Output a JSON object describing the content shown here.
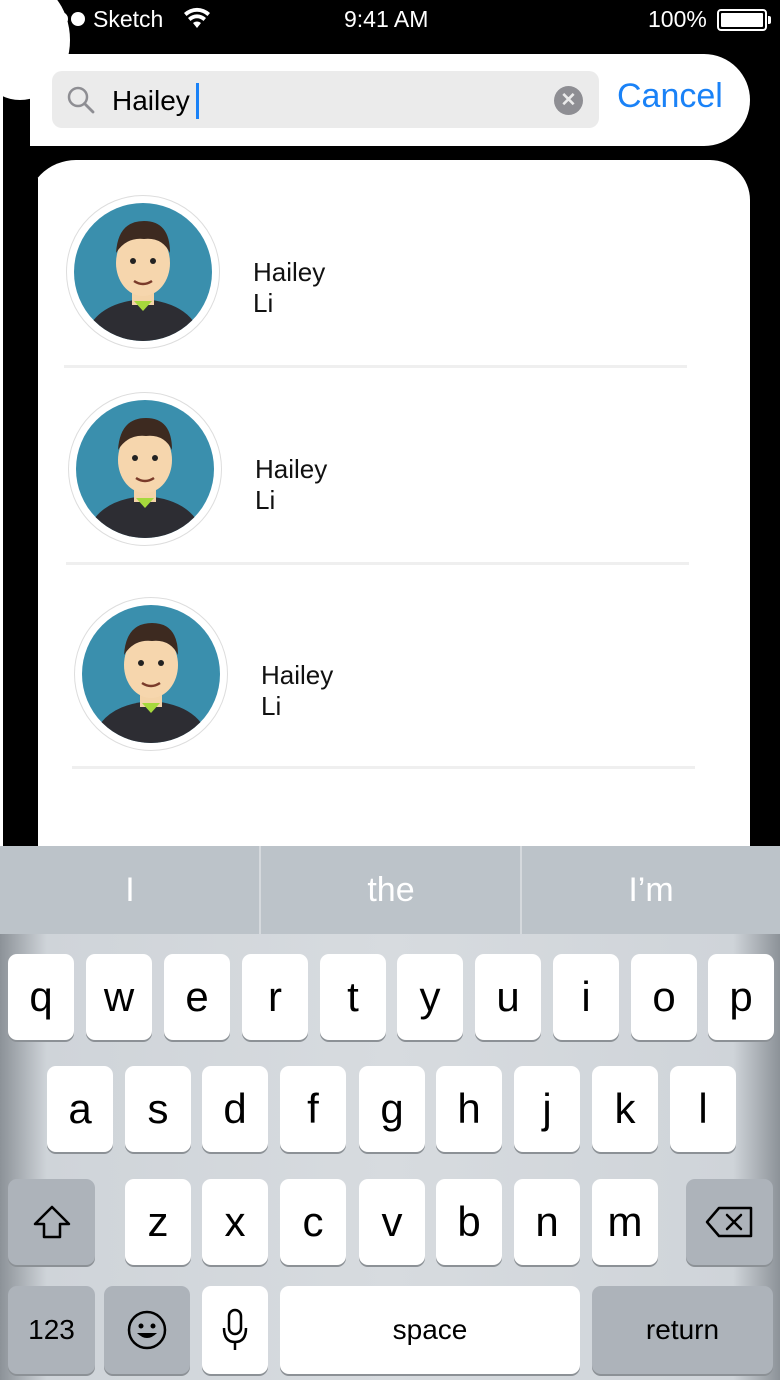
{
  "status_bar": {
    "carrier": "Sketch",
    "time": "9:41 AM",
    "battery": "100%"
  },
  "search": {
    "query": "Hailey",
    "cancel_label": "Cancel"
  },
  "results": [
    {
      "name": "Hailey Li"
    },
    {
      "name": "Hailey Li"
    },
    {
      "name": "Hailey Li"
    }
  ],
  "keyboard": {
    "suggestions": [
      "I",
      "the",
      "I’m"
    ],
    "row1": [
      "q",
      "w",
      "e",
      "r",
      "t",
      "y",
      "u",
      "i",
      "o",
      "p"
    ],
    "row2": [
      "a",
      "s",
      "d",
      "f",
      "g",
      "h",
      "j",
      "k",
      "l"
    ],
    "row3": [
      "z",
      "x",
      "c",
      "v",
      "b",
      "n",
      "m"
    ],
    "numbers_label": "123",
    "space_label": "space",
    "return_label": "return"
  },
  "colors": {
    "accent": "#1a82f7",
    "caret": "#1a82f7"
  }
}
